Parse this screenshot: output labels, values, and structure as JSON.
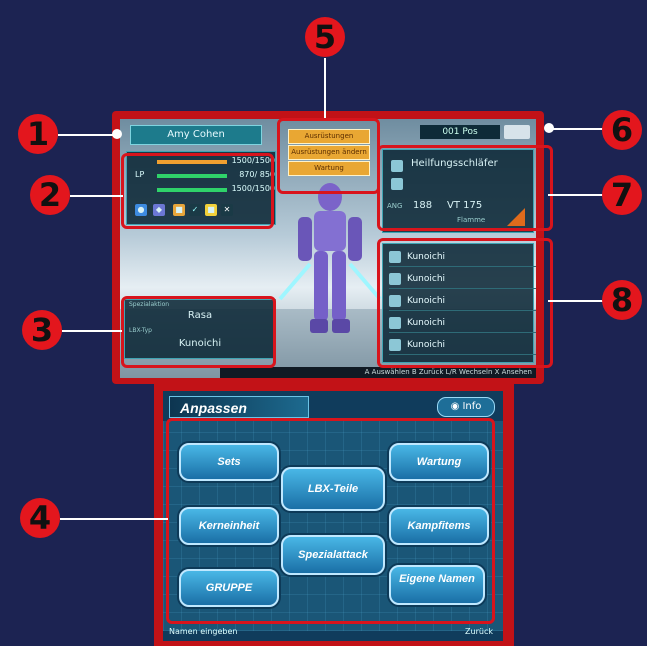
{
  "callouts": [
    "1",
    "2",
    "3",
    "4",
    "5",
    "6",
    "7",
    "8"
  ],
  "top": {
    "character_name": "Amy Cohen",
    "system_label": "001 Pos",
    "stats": [
      {
        "label": "",
        "value": "1500/1500"
      },
      {
        "label": "LP",
        "value": "870/ 850"
      },
      {
        "label": "",
        "value": "1500/1500"
      }
    ],
    "top_buttons": [
      "Ausrüstungen",
      "Ausrüstungen ändern",
      "Wartung"
    ],
    "weapon": {
      "name": "Heilfungsschläfer",
      "atk": "188",
      "vt": "VT 175",
      "type": "Flamme"
    },
    "info_left": {
      "title": "Spezialaktion",
      "row1": "Rasa",
      "row2_label": "LBX-Typ",
      "row2": "Kunoichi"
    },
    "parts": [
      "Kunoichi",
      "Kunoichi",
      "Kunoichi",
      "Kunoichi",
      "Kunoichi"
    ],
    "footer_hint": "A Auswählen  B Zurück  L/R Wechseln  X Ansehen"
  },
  "bottom": {
    "title": "Anpassen",
    "info_label": "Info",
    "menu": {
      "sets": "Sets",
      "lbx_teile": "LBX-Teile",
      "wartung": "Wartung",
      "kerneinheit": "Kerneinheit",
      "kampfitems": "Kampfitems",
      "spezialattack": "Spezialattack",
      "gruppe": "GRUPPE",
      "eigene_namen": "Eigene Namen"
    },
    "footer_left": "Namen eingeben",
    "footer_right": "Zurück"
  },
  "colors": {
    "background": "#1c2352",
    "frame": "#d8141c",
    "callout": "#e3161d"
  }
}
